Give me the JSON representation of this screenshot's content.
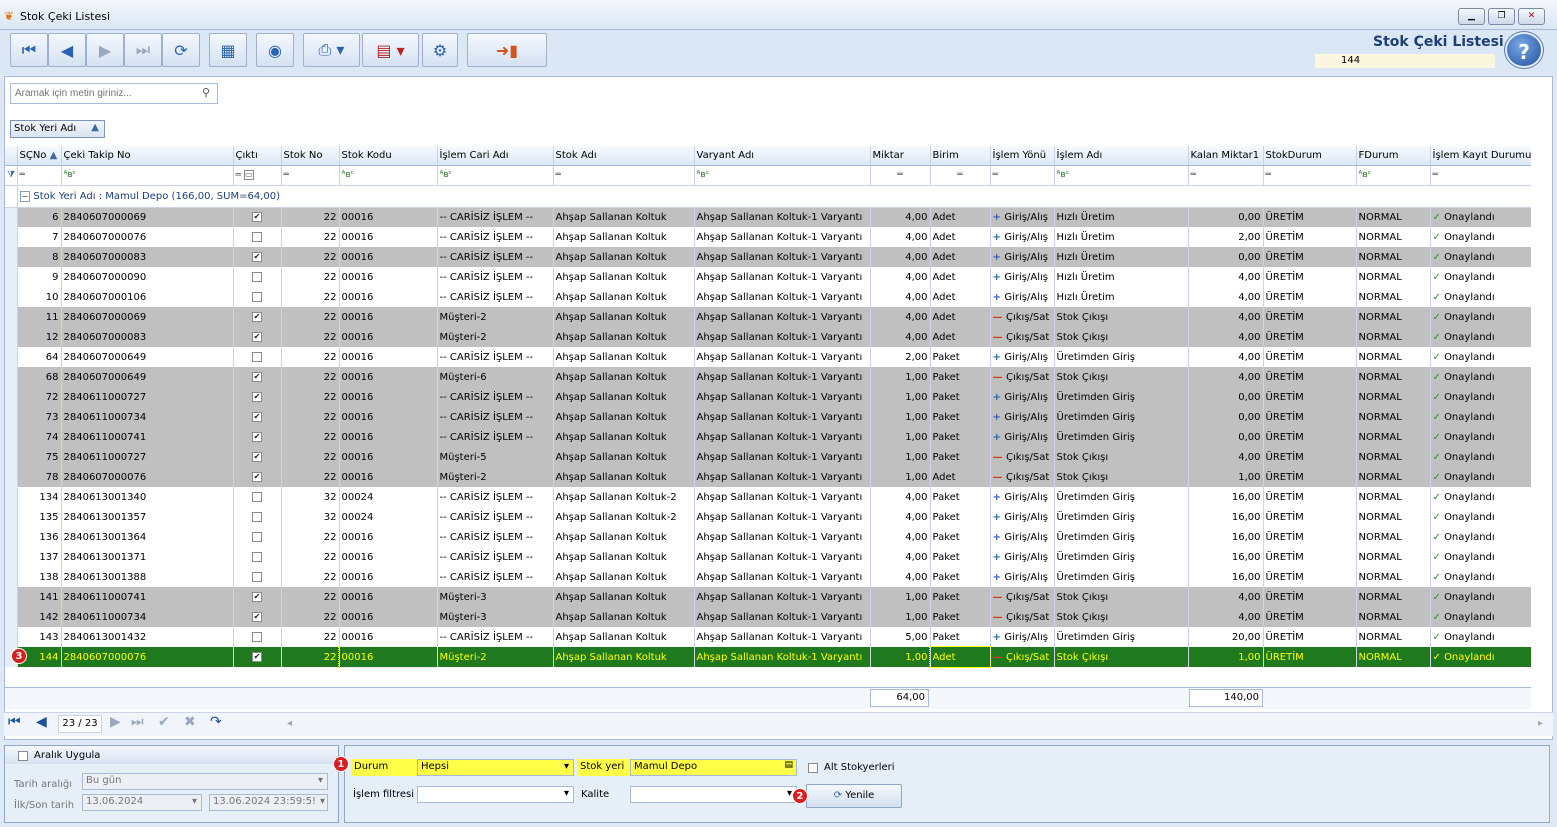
{
  "window": {
    "title": "Stok Çeki Listesi",
    "buttons": [
      "▁",
      "❐",
      "✕"
    ]
  },
  "header": {
    "title": "Stok Çeki Listesi",
    "count": "144",
    "help": "?"
  },
  "search": {
    "placeholder": "Aramak için metin giriniz..."
  },
  "group_chip": "Stok Yeri Adı",
  "columns": [
    "SÇNo",
    "Çeki Takip No",
    "Çıktı",
    "Stok No",
    "Stok Kodu",
    "İşlem Cari Adı",
    "Stok Adı",
    "Varyant Adı",
    "Miktar",
    "Birim",
    "İşlem Yönü",
    "İşlem Adı",
    "Kalan Miktar1",
    "StokDurum",
    "FDurum",
    "İşlem Kayıt Durumu"
  ],
  "group_row": "Stok Yeri Adı : Mamul Depo (166,00, SUM=64,00)",
  "rows": [
    {
      "no": "6",
      "takip": "2840607000069",
      "cikti": true,
      "stokno": "22",
      "kod": "00016",
      "cari": "-- CARİSİZ İŞLEM --",
      "stok": "Ahşap Sallanan Koltuk",
      "varyant": "Ahşap Sallanan Koltuk-1 Varyantı",
      "miktar": "4,00",
      "birim": "Adet",
      "yon": "Giriş/Alış",
      "yon_type": "plus",
      "islem": "Hızlı Üretim",
      "kalan": "0,00",
      "sdurum": "ÜRETİM",
      "fdurum": "NORMAL",
      "kayit": "Onaylandı"
    },
    {
      "no": "7",
      "takip": "2840607000076",
      "cikti": false,
      "stokno": "22",
      "kod": "00016",
      "cari": "-- CARİSİZ İŞLEM --",
      "stok": "Ahşap Sallanan Koltuk",
      "varyant": "Ahşap Sallanan Koltuk-1 Varyantı",
      "miktar": "4,00",
      "birim": "Adet",
      "yon": "Giriş/Alış",
      "yon_type": "plus",
      "islem": "Hızlı Üretim",
      "kalan": "2,00",
      "sdurum": "ÜRETİM",
      "fdurum": "NORMAL",
      "kayit": "Onaylandı"
    },
    {
      "no": "8",
      "takip": "2840607000083",
      "cikti": true,
      "stokno": "22",
      "kod": "00016",
      "cari": "-- CARİSİZ İŞLEM --",
      "stok": "Ahşap Sallanan Koltuk",
      "varyant": "Ahşap Sallanan Koltuk-1 Varyantı",
      "miktar": "4,00",
      "birim": "Adet",
      "yon": "Giriş/Alış",
      "yon_type": "plus",
      "islem": "Hızlı Üretim",
      "kalan": "0,00",
      "sdurum": "ÜRETİM",
      "fdurum": "NORMAL",
      "kayit": "Onaylandı"
    },
    {
      "no": "9",
      "takip": "2840607000090",
      "cikti": false,
      "stokno": "22",
      "kod": "00016",
      "cari": "-- CARİSİZ İŞLEM --",
      "stok": "Ahşap Sallanan Koltuk",
      "varyant": "Ahşap Sallanan Koltuk-1 Varyantı",
      "miktar": "4,00",
      "birim": "Adet",
      "yon": "Giriş/Alış",
      "yon_type": "plus",
      "islem": "Hızlı Üretim",
      "kalan": "4,00",
      "sdurum": "ÜRETİM",
      "fdurum": "NORMAL",
      "kayit": "Onaylandı"
    },
    {
      "no": "10",
      "takip": "2840607000106",
      "cikti": false,
      "stokno": "22",
      "kod": "00016",
      "cari": "-- CARİSİZ İŞLEM --",
      "stok": "Ahşap Sallanan Koltuk",
      "varyant": "Ahşap Sallanan Koltuk-1 Varyantı",
      "miktar": "4,00",
      "birim": "Adet",
      "yon": "Giriş/Alış",
      "yon_type": "plus",
      "islem": "Hızlı Üretim",
      "kalan": "4,00",
      "sdurum": "ÜRETİM",
      "fdurum": "NORMAL",
      "kayit": "Onaylandı"
    },
    {
      "no": "11",
      "takip": "2840607000069",
      "cikti": true,
      "stokno": "22",
      "kod": "00016",
      "cari": "Müşteri-2",
      "stok": "Ahşap Sallanan Koltuk",
      "varyant": "Ahşap Sallanan Koltuk-1 Varyantı",
      "miktar": "4,00",
      "birim": "Adet",
      "yon": "Çıkış/Sat",
      "yon_type": "minus",
      "islem": "Stok Çıkışı",
      "kalan": "4,00",
      "sdurum": "ÜRETİM",
      "fdurum": "NORMAL",
      "kayit": "Onaylandı"
    },
    {
      "no": "12",
      "takip": "2840607000083",
      "cikti": true,
      "stokno": "22",
      "kod": "00016",
      "cari": "Müşteri-2",
      "stok": "Ahşap Sallanan Koltuk",
      "varyant": "Ahşap Sallanan Koltuk-1 Varyantı",
      "miktar": "4,00",
      "birim": "Adet",
      "yon": "Çıkış/Sat",
      "yon_type": "minus",
      "islem": "Stok Çıkışı",
      "kalan": "4,00",
      "sdurum": "ÜRETİM",
      "fdurum": "NORMAL",
      "kayit": "Onaylandı"
    },
    {
      "no": "64",
      "takip": "2840607000649",
      "cikti": false,
      "stokno": "22",
      "kod": "00016",
      "cari": "-- CARİSİZ İŞLEM --",
      "stok": "Ahşap Sallanan Koltuk",
      "varyant": "Ahşap Sallanan Koltuk-1 Varyantı",
      "miktar": "2,00",
      "birim": "Paket",
      "yon": "Giriş/Alış",
      "yon_type": "plus",
      "islem": "Üretimden Giriş",
      "kalan": "4,00",
      "sdurum": "ÜRETİM",
      "fdurum": "NORMAL",
      "kayit": "Onaylandı"
    },
    {
      "no": "68",
      "takip": "2840607000649",
      "cikti": true,
      "stokno": "22",
      "kod": "00016",
      "cari": "Müşteri-6",
      "stok": "Ahşap Sallanan Koltuk",
      "varyant": "Ahşap Sallanan Koltuk-1 Varyantı",
      "miktar": "1,00",
      "birim": "Paket",
      "yon": "Çıkış/Sat",
      "yon_type": "minus",
      "islem": "Stok Çıkışı",
      "kalan": "4,00",
      "sdurum": "ÜRETİM",
      "fdurum": "NORMAL",
      "kayit": "Onaylandı"
    },
    {
      "no": "72",
      "takip": "2840611000727",
      "cikti": true,
      "stokno": "22",
      "kod": "00016",
      "cari": "-- CARİSİZ İŞLEM --",
      "stok": "Ahşap Sallanan Koltuk",
      "varyant": "Ahşap Sallanan Koltuk-1 Varyantı",
      "miktar": "1,00",
      "birim": "Paket",
      "yon": "Giriş/Alış",
      "yon_type": "plus",
      "islem": "Üretimden Giriş",
      "kalan": "0,00",
      "sdurum": "ÜRETİM",
      "fdurum": "NORMAL",
      "kayit": "Onaylandı"
    },
    {
      "no": "73",
      "takip": "2840611000734",
      "cikti": true,
      "stokno": "22",
      "kod": "00016",
      "cari": "-- CARİSİZ İŞLEM --",
      "stok": "Ahşap Sallanan Koltuk",
      "varyant": "Ahşap Sallanan Koltuk-1 Varyantı",
      "miktar": "1,00",
      "birim": "Paket",
      "yon": "Giriş/Alış",
      "yon_type": "plus",
      "islem": "Üretimden Giriş",
      "kalan": "0,00",
      "sdurum": "ÜRETİM",
      "fdurum": "NORMAL",
      "kayit": "Onaylandı"
    },
    {
      "no": "74",
      "takip": "2840611000741",
      "cikti": true,
      "stokno": "22",
      "kod": "00016",
      "cari": "-- CARİSİZ İŞLEM --",
      "stok": "Ahşap Sallanan Koltuk",
      "varyant": "Ahşap Sallanan Koltuk-1 Varyantı",
      "miktar": "1,00",
      "birim": "Paket",
      "yon": "Giriş/Alış",
      "yon_type": "plus",
      "islem": "Üretimden Giriş",
      "kalan": "0,00",
      "sdurum": "ÜRETİM",
      "fdurum": "NORMAL",
      "kayit": "Onaylandı"
    },
    {
      "no": "75",
      "takip": "2840611000727",
      "cikti": true,
      "stokno": "22",
      "kod": "00016",
      "cari": "Müşteri-5",
      "stok": "Ahşap Sallanan Koltuk",
      "varyant": "Ahşap Sallanan Koltuk-1 Varyantı",
      "miktar": "1,00",
      "birim": "Paket",
      "yon": "Çıkış/Sat",
      "yon_type": "minus",
      "islem": "Stok Çıkışı",
      "kalan": "4,00",
      "sdurum": "ÜRETİM",
      "fdurum": "NORMAL",
      "kayit": "Onaylandı"
    },
    {
      "no": "78",
      "takip": "2840607000076",
      "cikti": true,
      "stokno": "22",
      "kod": "00016",
      "cari": "Müşteri-2",
      "stok": "Ahşap Sallanan Koltuk",
      "varyant": "Ahşap Sallanan Koltuk-1 Varyantı",
      "miktar": "1,00",
      "birim": "Adet",
      "yon": "Çıkış/Sat",
      "yon_type": "minus",
      "islem": "Stok Çıkışı",
      "kalan": "1,00",
      "sdurum": "ÜRETİM",
      "fdurum": "NORMAL",
      "kayit": "Onaylandı"
    },
    {
      "no": "134",
      "takip": "2840613001340",
      "cikti": false,
      "stokno": "32",
      "kod": "00024",
      "cari": "-- CARİSİZ İŞLEM --",
      "stok": "Ahşap Sallanan Koltuk-2",
      "varyant": "Ahşap Sallanan Koltuk-1 Varyantı",
      "miktar": "4,00",
      "birim": "Paket",
      "yon": "Giriş/Alış",
      "yon_type": "plus",
      "islem": "Üretimden Giriş",
      "kalan": "16,00",
      "sdurum": "ÜRETİM",
      "fdurum": "NORMAL",
      "kayit": "Onaylandı"
    },
    {
      "no": "135",
      "takip": "2840613001357",
      "cikti": false,
      "stokno": "32",
      "kod": "00024",
      "cari": "-- CARİSİZ İŞLEM --",
      "stok": "Ahşap Sallanan Koltuk-2",
      "varyant": "Ahşap Sallanan Koltuk-1 Varyantı",
      "miktar": "4,00",
      "birim": "Paket",
      "yon": "Giriş/Alış",
      "yon_type": "plus",
      "islem": "Üretimden Giriş",
      "kalan": "16,00",
      "sdurum": "ÜRETİM",
      "fdurum": "NORMAL",
      "kayit": "Onaylandı"
    },
    {
      "no": "136",
      "takip": "2840613001364",
      "cikti": false,
      "stokno": "22",
      "kod": "00016",
      "cari": "-- CARİSİZ İŞLEM --",
      "stok": "Ahşap Sallanan Koltuk",
      "varyant": "Ahşap Sallanan Koltuk-1 Varyantı",
      "miktar": "4,00",
      "birim": "Paket",
      "yon": "Giriş/Alış",
      "yon_type": "plus",
      "islem": "Üretimden Giriş",
      "kalan": "16,00",
      "sdurum": "ÜRETİM",
      "fdurum": "NORMAL",
      "kayit": "Onaylandı"
    },
    {
      "no": "137",
      "takip": "2840613001371",
      "cikti": false,
      "stokno": "22",
      "kod": "00016",
      "cari": "-- CARİSİZ İŞLEM --",
      "stok": "Ahşap Sallanan Koltuk",
      "varyant": "Ahşap Sallanan Koltuk-1 Varyantı",
      "miktar": "4,00",
      "birim": "Paket",
      "yon": "Giriş/Alış",
      "yon_type": "plus",
      "islem": "Üretimden Giriş",
      "kalan": "16,00",
      "sdurum": "ÜRETİM",
      "fdurum": "NORMAL",
      "kayit": "Onaylandı"
    },
    {
      "no": "138",
      "takip": "2840613001388",
      "cikti": false,
      "stokno": "22",
      "kod": "00016",
      "cari": "-- CARİSİZ İŞLEM --",
      "stok": "Ahşap Sallanan Koltuk",
      "varyant": "Ahşap Sallanan Koltuk-1 Varyantı",
      "miktar": "4,00",
      "birim": "Paket",
      "yon": "Giriş/Alış",
      "yon_type": "plus",
      "islem": "Üretimden Giriş",
      "kalan": "16,00",
      "sdurum": "ÜRETİM",
      "fdurum": "NORMAL",
      "kayit": "Onaylandı"
    },
    {
      "no": "141",
      "takip": "2840611000741",
      "cikti": true,
      "stokno": "22",
      "kod": "00016",
      "cari": "Müşteri-3",
      "stok": "Ahşap Sallanan Koltuk",
      "varyant": "Ahşap Sallanan Koltuk-1 Varyantı",
      "miktar": "1,00",
      "birim": "Paket",
      "yon": "Çıkış/Sat",
      "yon_type": "minus",
      "islem": "Stok Çıkışı",
      "kalan": "4,00",
      "sdurum": "ÜRETİM",
      "fdurum": "NORMAL",
      "kayit": "Onaylandı"
    },
    {
      "no": "142",
      "takip": "2840611000734",
      "cikti": true,
      "stokno": "22",
      "kod": "00016",
      "cari": "Müşteri-3",
      "stok": "Ahşap Sallanan Koltuk",
      "varyant": "Ahşap Sallanan Koltuk-1 Varyantı",
      "miktar": "1,00",
      "birim": "Paket",
      "yon": "Çıkış/Sat",
      "yon_type": "minus",
      "islem": "Stok Çıkışı",
      "kalan": "4,00",
      "sdurum": "ÜRETİM",
      "fdurum": "NORMAL",
      "kayit": "Onaylandı"
    },
    {
      "no": "143",
      "takip": "2840613001432",
      "cikti": false,
      "stokno": "22",
      "kod": "00016",
      "cari": "-- CARİSİZ İŞLEM --",
      "stok": "Ahşap Sallanan Koltuk",
      "varyant": "Ahşap Sallanan Koltuk-1 Varyantı",
      "miktar": "5,00",
      "birim": "Paket",
      "yon": "Giriş/Alış",
      "yon_type": "plus",
      "islem": "Üretimden Giriş",
      "kalan": "20,00",
      "sdurum": "ÜRETİM",
      "fdurum": "NORMAL",
      "kayit": "Onaylandı"
    },
    {
      "no": "144",
      "takip": "2840607000076",
      "cikti": true,
      "stokno": "22",
      "kod": "00016",
      "cari": "Müşteri-2",
      "stok": "Ahşap Sallanan Koltuk",
      "varyant": "Ahşap Sallanan Koltuk-1 Varyantı",
      "miktar": "1,00",
      "birim": "Adet",
      "yon": "Çıkış/Sat",
      "yon_type": "minus",
      "islem": "Stok Çıkışı",
      "kalan": "1,00",
      "sdurum": "ÜRETİM",
      "fdurum": "NORMAL",
      "kayit": "Onaylandı",
      "selected": true
    }
  ],
  "totals": {
    "miktar": "64,00",
    "kalan": "140,00"
  },
  "nav": {
    "page": "23 / 23"
  },
  "range_panel": {
    "title": "Aralık Uygula",
    "tarih_label": "Tarih aralığı",
    "tarih_value": "Bu gün",
    "ilkson_label": "İlk/Son tarih",
    "start": "13.06.2024",
    "end": "13.06.2024 23:59:5!"
  },
  "filter_panel": {
    "durum_label": "Durum",
    "durum_value": "Hepsi",
    "stokyeri_label": "Stok yeri",
    "stokyeri_value": "Mamul Depo",
    "alt_label": "Alt Stokyerleri",
    "islem_label": "İşlem filtresi",
    "kalite_label": "Kalite",
    "yenile": "Yenile"
  },
  "badges": {
    "b1": "1",
    "b2": "2",
    "b3": "3"
  },
  "colors": {
    "selected_row": "#1f7a1f",
    "selected_text": "#ffff00",
    "highlight_field": "#ffff4a",
    "dark_row": "#c0c0c0"
  }
}
